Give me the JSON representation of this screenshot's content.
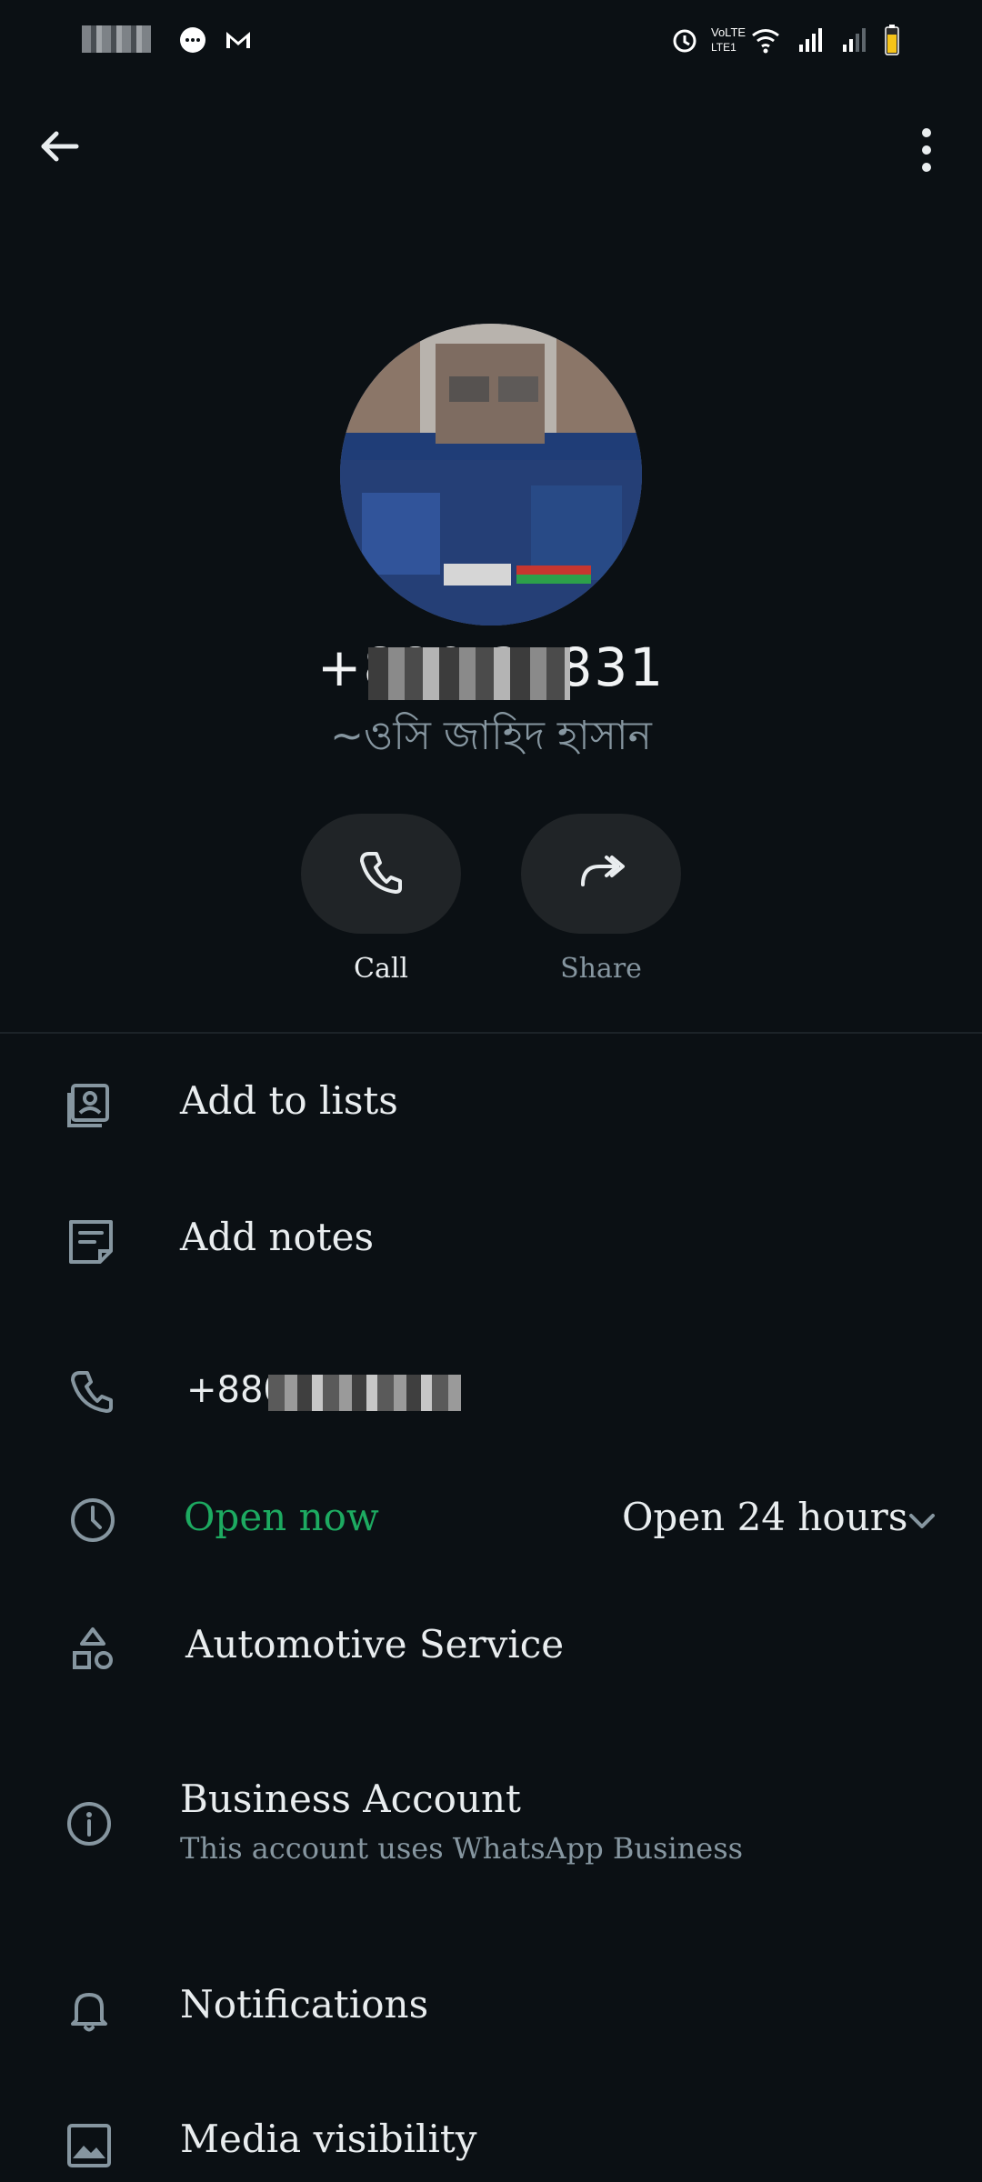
{
  "status_bar": {
    "icons": [
      "message-icon",
      "gmail-icon",
      "alarm-icon",
      "volte-icon",
      "wifi-icon",
      "signal-icon",
      "signal-icon",
      "battery-icon"
    ]
  },
  "profile": {
    "phone_title": "+880 35831",
    "name": "~ওসি জাহিদ হাসান"
  },
  "actions": {
    "call_label": "Call",
    "share_label": "Share"
  },
  "rows": {
    "add_to_lists": "Add to lists",
    "add_notes": "Add notes",
    "phone_number": "+880 35831",
    "open_now": "Open now",
    "open_hours": "Open 24 hours",
    "category": "Automotive Service",
    "business_account_title": "Business Account",
    "business_account_sub": "This account uses WhatsApp Business",
    "notifications": "Notifications",
    "media_visibility": "Media visibility"
  },
  "colors": {
    "background": "#0b1014",
    "accent_green": "#1daa61",
    "muted": "#8696a0",
    "pill": "#202427"
  }
}
